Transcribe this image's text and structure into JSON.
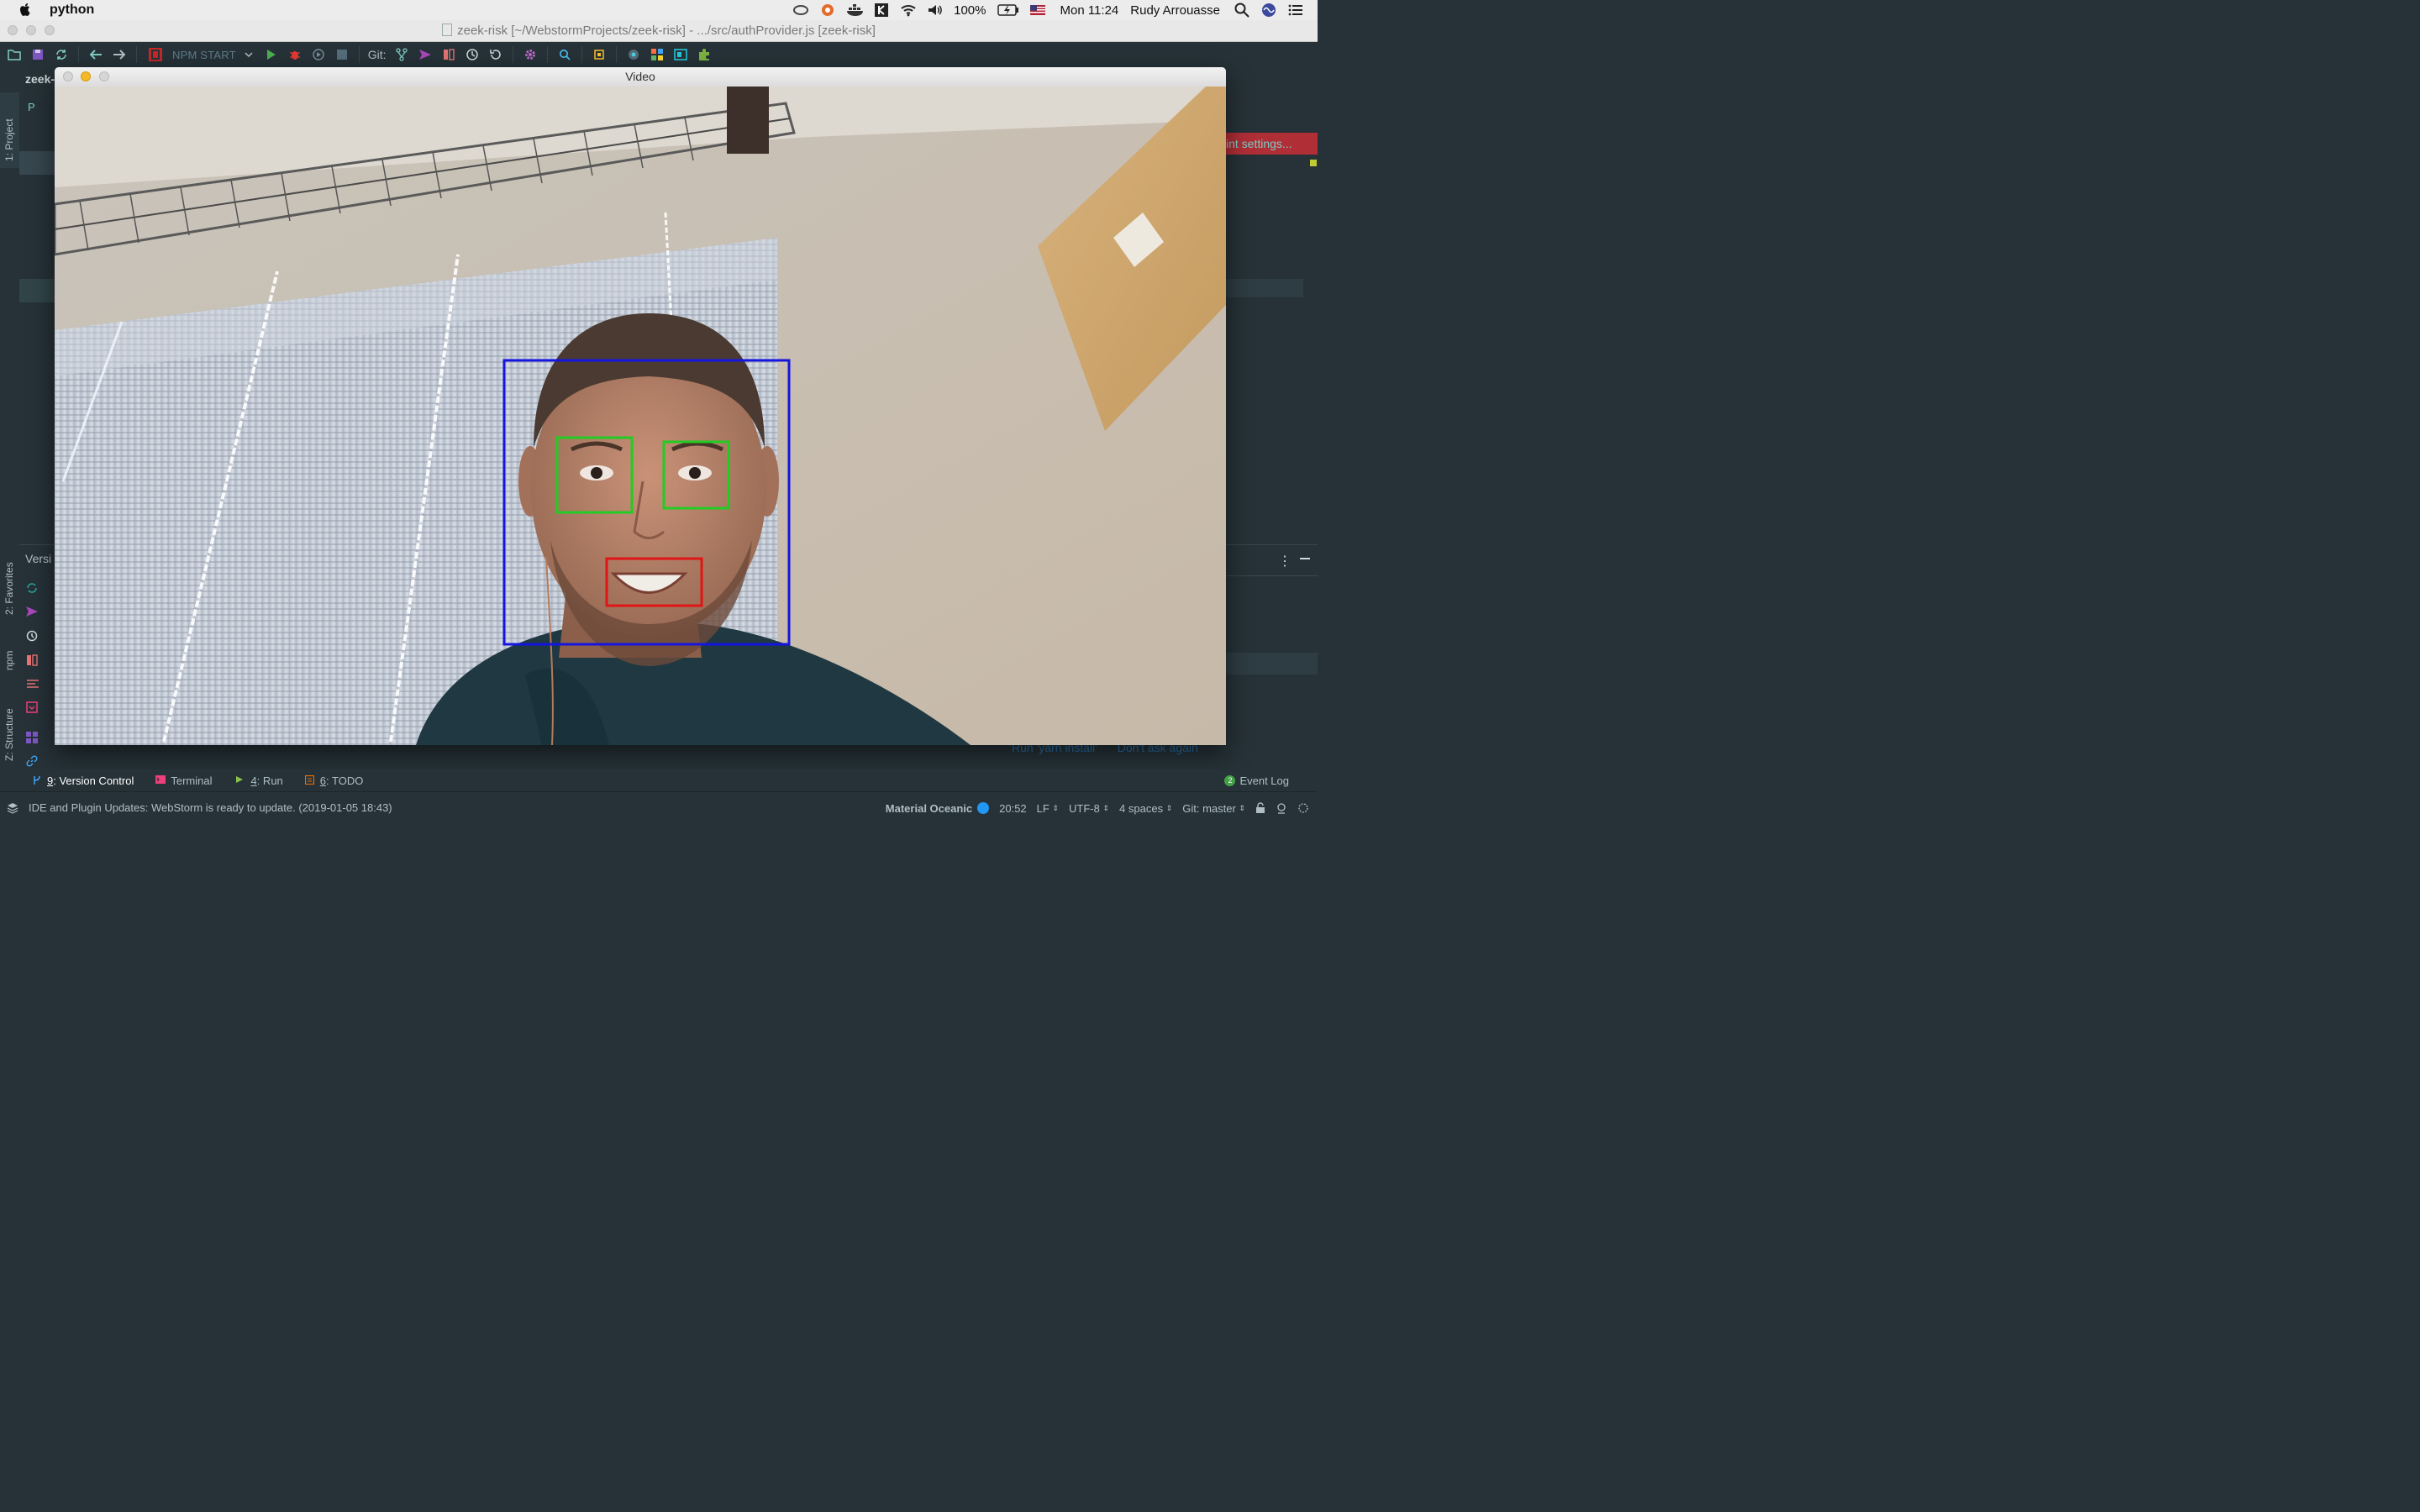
{
  "menubar": {
    "app_name": "python",
    "battery": "100%",
    "clock": "Mon 11:24",
    "user": "Rudy Arrouasse",
    "icons": [
      "apple-icon",
      "creative-cloud-icon",
      "uploader-icon",
      "docker-icon",
      "app-icon",
      "wifi-icon",
      "volume-icon",
      "battery-icon",
      "flag-icon",
      "search-icon",
      "siri-icon",
      "notification-center-icon"
    ]
  },
  "ide": {
    "window_title": "zeek-risk [~/WebstormProjects/zeek-risk] - .../src/authProvider.js [zeek-risk]",
    "project_name": "zeek-",
    "run_config": "NPM START",
    "git_label": "Git:",
    "lint_banner": "int settings...",
    "side_tabs": {
      "project": "1: Project",
      "favorites": "2: Favorites",
      "npm": "npm",
      "structure": "Z: Structure"
    },
    "panel_fragments": {
      "project_tab": "P",
      "version_control": "Versi"
    }
  },
  "video_window": {
    "title": "Video",
    "detections": [
      {
        "label": "face",
        "color": "#1515e0"
      },
      {
        "label": "eye",
        "color": "#22cc22"
      },
      {
        "label": "eye",
        "color": "#22cc22"
      },
      {
        "label": "mouth",
        "color": "#e01515"
      }
    ]
  },
  "tool_tabs": [
    {
      "num": "9",
      "label": ": Version Control",
      "active": true
    },
    {
      "num": "",
      "label": "Terminal",
      "active": false
    },
    {
      "num": "4",
      "label": ": Run",
      "active": false
    },
    {
      "num": "6",
      "label": ": TODO",
      "active": false
    }
  ],
  "event_log": {
    "count": "2",
    "label": "Event Log"
  },
  "notification_links": {
    "install": "Run 'yarn install'",
    "dismiss": "Don't ask again"
  },
  "statusbar": {
    "message": "IDE and Plugin Updates: WebStorm is ready to update. (2019-01-05 18:43)",
    "theme": "Material Oceanic",
    "position": "20:52",
    "line_sep": "LF",
    "encoding": "UTF-8",
    "indent": "4 spaces",
    "git_branch": "Git: master"
  },
  "colors": {
    "ide_bg": "#263238",
    "accent": "#80cbc4",
    "theme_dot": "#2196f3"
  }
}
